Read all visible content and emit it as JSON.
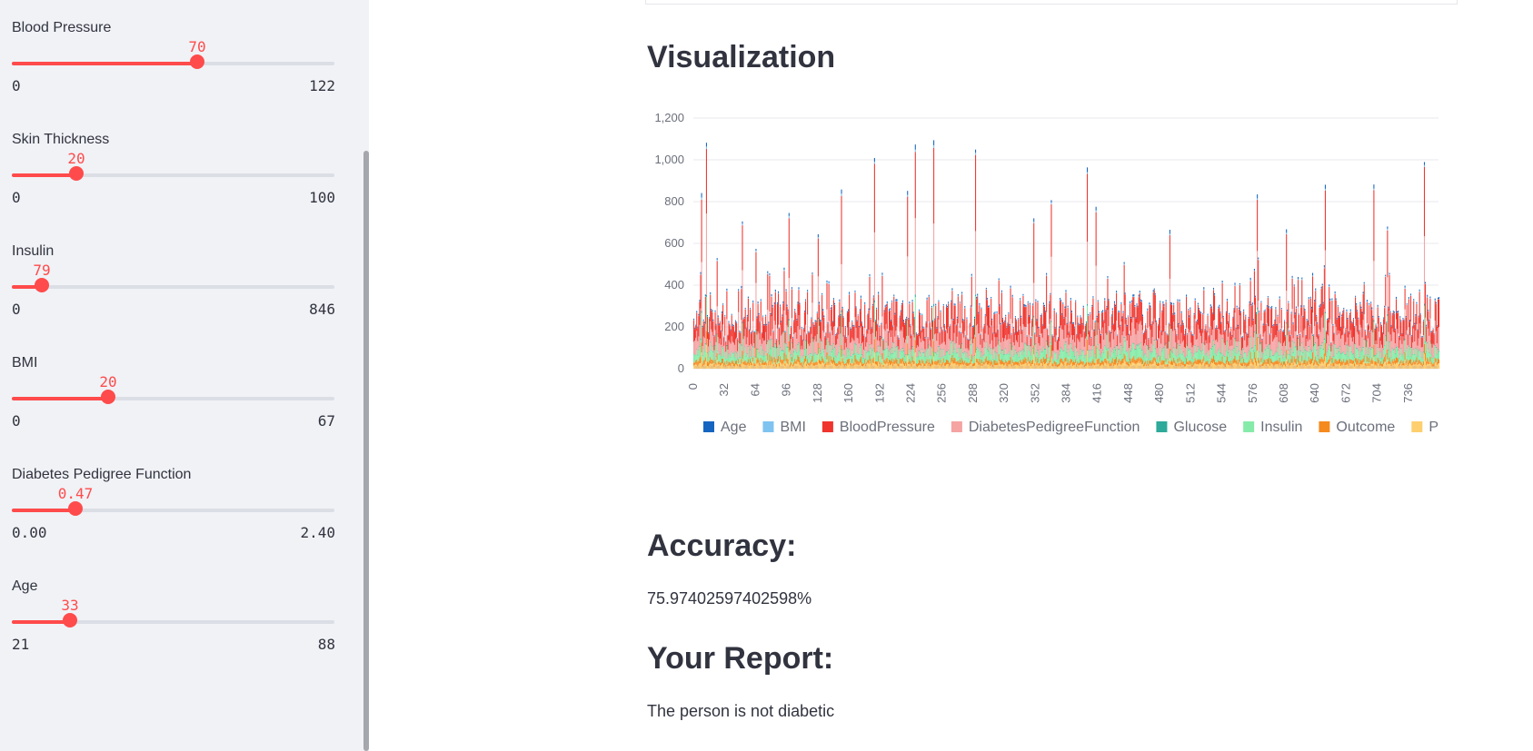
{
  "sidebar": {
    "sliders": [
      {
        "label": "Blood Pressure",
        "value": 70,
        "value_text": "70",
        "min": 0,
        "max": 122,
        "min_text": "0",
        "max_text": "122"
      },
      {
        "label": "Skin Thickness",
        "value": 20,
        "value_text": "20",
        "min": 0,
        "max": 100,
        "min_text": "0",
        "max_text": "100"
      },
      {
        "label": "Insulin",
        "value": 79,
        "value_text": "79",
        "min": 0,
        "max": 846,
        "min_text": "0",
        "max_text": "846"
      },
      {
        "label": "BMI",
        "value": 20,
        "value_text": "20",
        "min": 0,
        "max": 67,
        "min_text": "0",
        "max_text": "67"
      },
      {
        "label": "Diabetes Pedigree Function",
        "value": 0.47,
        "value_text": "0.47",
        "min": 0,
        "max": 2.4,
        "min_text": "0.00",
        "max_text": "2.40"
      },
      {
        "label": "Age",
        "value": 33,
        "value_text": "33",
        "min": 21,
        "max": 88,
        "min_text": "21",
        "max_text": "88"
      }
    ]
  },
  "main": {
    "visualization_heading": "Visualization",
    "accuracy_heading": "Accuracy:",
    "accuracy_value": "75.97402597402598%",
    "report_heading": "Your Report:",
    "report_text": "The person is not diabetic"
  },
  "chart_data": {
    "type": "bar",
    "stacked": true,
    "ylim": [
      0,
      1200
    ],
    "y_ticks": [
      0,
      200,
      400,
      600,
      800,
      1000,
      1200
    ],
    "y_tick_labels": [
      "0",
      "200",
      "400",
      "600",
      "800",
      "1,000",
      "1,200"
    ],
    "x_range": [
      0,
      767
    ],
    "x_ticks": [
      "0",
      "32",
      "64",
      "96",
      "128",
      "160",
      "192",
      "224",
      "256",
      "288",
      "320",
      "352",
      "384",
      "416",
      "448",
      "480",
      "512",
      "544",
      "576",
      "608",
      "640",
      "672",
      "704",
      "736"
    ],
    "series": [
      {
        "name": "Age",
        "color": "#1565c0"
      },
      {
        "name": "BMI",
        "color": "#7fc3f0"
      },
      {
        "name": "BloodPressure",
        "color": "#f0352e"
      },
      {
        "name": "DiabetesPedigreeFunction",
        "color": "#f5a3a3"
      },
      {
        "name": "Glucose",
        "color": "#2ea99a"
      },
      {
        "name": "Insulin",
        "color": "#86eba8"
      },
      {
        "name": "Outcome",
        "color": "#f58a1f"
      },
      {
        "name": "Preg",
        "color": "#fdcf6e"
      }
    ],
    "visible_peaks": [
      {
        "x": 8,
        "total": 940
      },
      {
        "x": 13,
        "total": 1210
      },
      {
        "x": 24,
        "total": 560
      },
      {
        "x": 50,
        "total": 700
      },
      {
        "x": 64,
        "total": 580
      },
      {
        "x": 98,
        "total": 830
      },
      {
        "x": 128,
        "total": 690
      },
      {
        "x": 152,
        "total": 830
      },
      {
        "x": 186,
        "total": 880
      },
      {
        "x": 220,
        "total": 800
      },
      {
        "x": 228,
        "total": 1120
      },
      {
        "x": 247,
        "total": 1040
      },
      {
        "x": 290,
        "total": 910
      },
      {
        "x": 350,
        "total": 660
      },
      {
        "x": 368,
        "total": 840
      },
      {
        "x": 405,
        "total": 940
      },
      {
        "x": 414,
        "total": 820
      },
      {
        "x": 490,
        "total": 760
      },
      {
        "x": 580,
        "total": 920
      },
      {
        "x": 610,
        "total": 680
      },
      {
        "x": 650,
        "total": 820
      },
      {
        "x": 700,
        "total": 820
      },
      {
        "x": 714,
        "total": 740
      },
      {
        "x": 752,
        "total": 890
      }
    ],
    "baseline_band": [
      150,
      350
    ],
    "grid": true,
    "legend_position": "bottom"
  }
}
